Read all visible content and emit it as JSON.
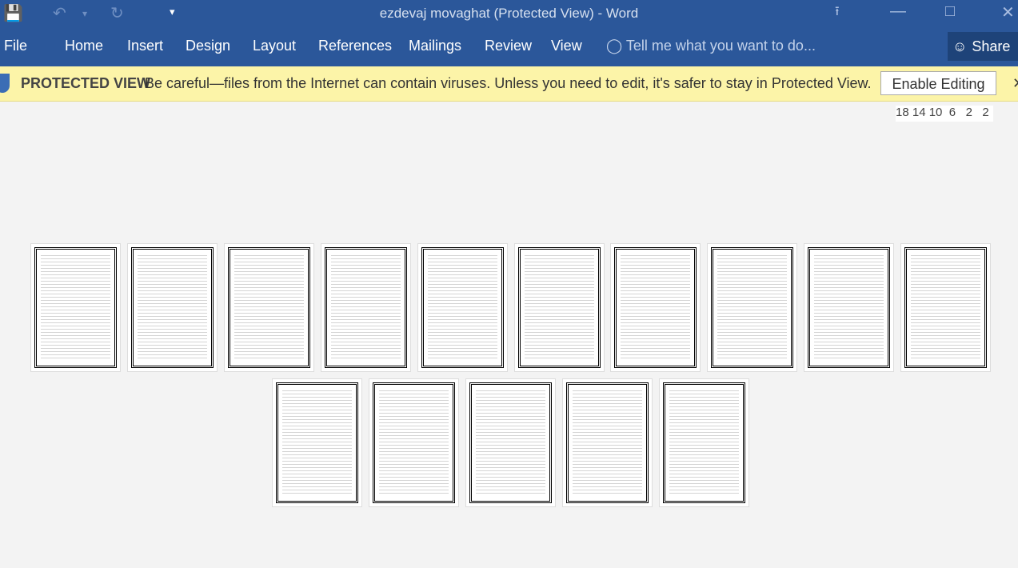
{
  "window": {
    "title": "ezdevaj movaghat (Protected View) - Word"
  },
  "quick_access": {
    "save": "💾",
    "undo": "↶",
    "undo_dd": "▾",
    "redo": "↻",
    "customize": "▾"
  },
  "window_controls": {
    "ribbon_display": "⭱",
    "minimize": "—",
    "maximize": "□",
    "close": "✕"
  },
  "ribbon": {
    "tabs": [
      "File",
      "Home",
      "Insert",
      "Design",
      "Layout",
      "References",
      "Mailings",
      "Review",
      "View"
    ],
    "tell_me": "Tell me what you want to do...",
    "share": "Share"
  },
  "protected_view": {
    "label": "PROTECTED VIEW",
    "message": "Be careful—files from the Internet can contain viruses. Unless you need to edit, it's safer to stay in Protected View.",
    "button": "Enable Editing",
    "close": "✕"
  },
  "ruler": {
    "ticks": "18 14 10  6   2   2"
  },
  "document": {
    "page_count": 15,
    "row1_pages": 10,
    "row2_pages": 5
  }
}
